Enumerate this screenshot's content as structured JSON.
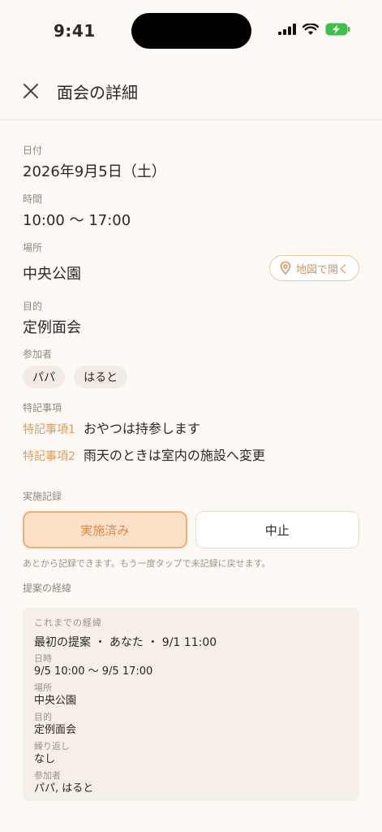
{
  "status_bar": {
    "time": "9:41"
  },
  "header": {
    "title": "面会の詳細"
  },
  "date": {
    "label": "日付",
    "value": "2026年9月5日（土）"
  },
  "time": {
    "label": "時間",
    "value": "10:00 〜 17:00"
  },
  "place": {
    "label": "場所",
    "value": "中央公園",
    "map_button": "地図で開く"
  },
  "purpose": {
    "label": "目的",
    "value": "定例面会"
  },
  "participants": {
    "label": "参加者",
    "items": [
      "パパ",
      "はると"
    ]
  },
  "notes": {
    "label": "特記事項",
    "items": [
      {
        "key": "特記事項1",
        "value": "おやつは持参します"
      },
      {
        "key": "特記事項2",
        "value": "雨天のときは室内の施設へ変更"
      }
    ]
  },
  "record": {
    "label": "実施記録",
    "done_button": "実施済み",
    "cancel_button": "中止",
    "hint": "あとから記録できます。もう一度タップで未記録に戻せます。"
  },
  "history": {
    "label": "提案の経緯",
    "box_title": "これまでの経緯",
    "entry_title": "最初の提案 ・ あなた ・ 9/1 11:00",
    "fields": [
      {
        "label": "日時",
        "value": "9/5 10:00 〜 9/5 17:00"
      },
      {
        "label": "場所",
        "value": "中央公園"
      },
      {
        "label": "目的",
        "value": "定例面会"
      },
      {
        "label": "繰り返し",
        "value": "なし"
      },
      {
        "label": "参加者",
        "value": "パパ, はると"
      }
    ]
  },
  "colors": {
    "accent": "#e19a5a",
    "background": "#fdfaf5",
    "battery": "#3fc04a"
  }
}
